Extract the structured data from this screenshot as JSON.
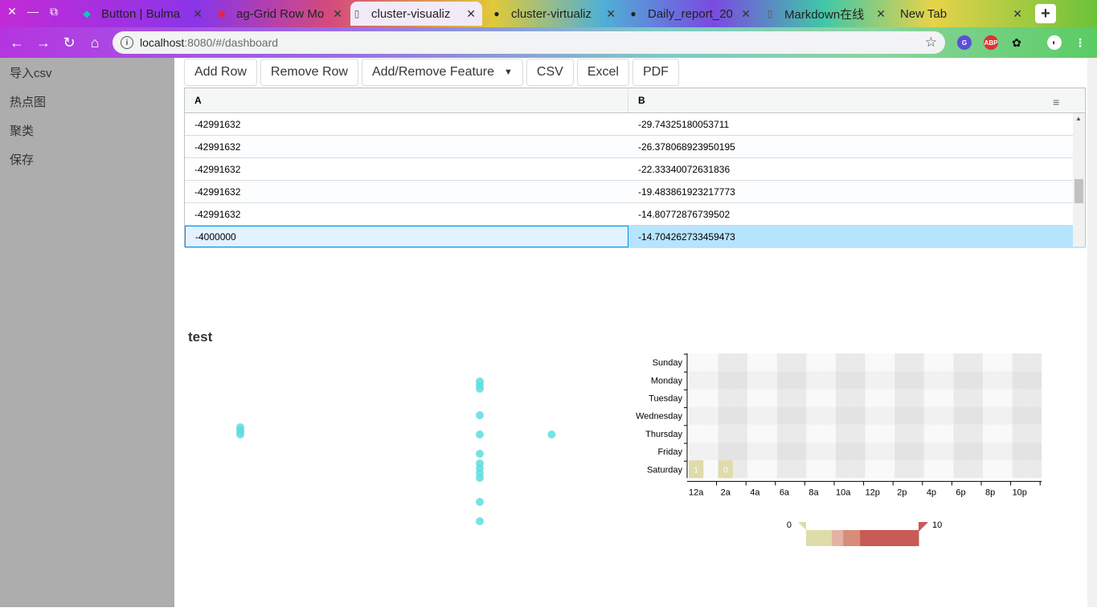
{
  "browser": {
    "tabs": [
      {
        "title": "Button | Bulma"
      },
      {
        "title": "ag-Grid Row Mo"
      },
      {
        "title": "cluster-visualiz"
      },
      {
        "title": "cluster-virtualiz"
      },
      {
        "title": "Daily_report_20"
      },
      {
        "title": "Markdown在线"
      },
      {
        "title": "New Tab"
      }
    ],
    "url_host": "localhost",
    "url_path": ":8080/#/dashboard"
  },
  "sidebar": {
    "items": [
      {
        "label": "导入csv"
      },
      {
        "label": "热点图"
      },
      {
        "label": "聚类"
      },
      {
        "label": "保存"
      }
    ]
  },
  "toolbar": {
    "add_row": "Add Row",
    "remove_row": "Remove Row",
    "add_remove_feature": "Add/Remove Feature",
    "csv": "CSV",
    "excel": "Excel",
    "pdf": "PDF"
  },
  "grid": {
    "headers": [
      "A",
      "B"
    ],
    "rows": [
      {
        "a": "-42991632",
        "b": "-29.74325180053711"
      },
      {
        "a": "-42991632",
        "b": "-26.378068923950195"
      },
      {
        "a": "-42991632",
        "b": "-22.33340072631836"
      },
      {
        "a": "-42991632",
        "b": "-19.483861923217773"
      },
      {
        "a": "-42991632",
        "b": "-14.80772876739502"
      },
      {
        "a": "-4000000",
        "b": "-14.704262733459473"
      }
    ]
  },
  "section_title": "test",
  "chart_data": [
    {
      "type": "scatter",
      "color": "#5fdde0",
      "points": [
        {
          "x": 1,
          "y": 7.0
        },
        {
          "x": 1,
          "y": 6.9
        },
        {
          "x": 1,
          "y": 6.8
        },
        {
          "x": 1,
          "y": 6.7
        },
        {
          "x": 2,
          "y": 8.9
        },
        {
          "x": 2,
          "y": 8.75
        },
        {
          "x": 2,
          "y": 8.6
        },
        {
          "x": 2,
          "y": 7.5
        },
        {
          "x": 2,
          "y": 6.7
        },
        {
          "x": 2,
          "y": 5.9
        },
        {
          "x": 2,
          "y": 5.5
        },
        {
          "x": 2,
          "y": 5.3
        },
        {
          "x": 2,
          "y": 5.1
        },
        {
          "x": 2,
          "y": 4.9
        },
        {
          "x": 2,
          "y": 3.9
        },
        {
          "x": 2,
          "y": 3.1
        },
        {
          "x": 2.3,
          "y": 6.7
        }
      ]
    },
    {
      "type": "heatmap",
      "y_categories": [
        "Sunday",
        "Monday",
        "Tuesday",
        "Wednesday",
        "Thursday",
        "Friday",
        "Saturday"
      ],
      "x_tick_labels": [
        "12a",
        "2a",
        "4a",
        "6a",
        "8a",
        "10a",
        "12p",
        "2p",
        "4p",
        "6p",
        "8p",
        "10p"
      ],
      "cells": [
        {
          "day": "Saturday",
          "hour": 0,
          "value": 1
        },
        {
          "day": "Saturday",
          "hour": 2,
          "value": 0
        }
      ],
      "color_range": [
        0,
        10
      ],
      "colors": [
        "#e0dbaa",
        "#e3b2a2",
        "#d98c7a",
        "#c95a55"
      ]
    }
  ]
}
